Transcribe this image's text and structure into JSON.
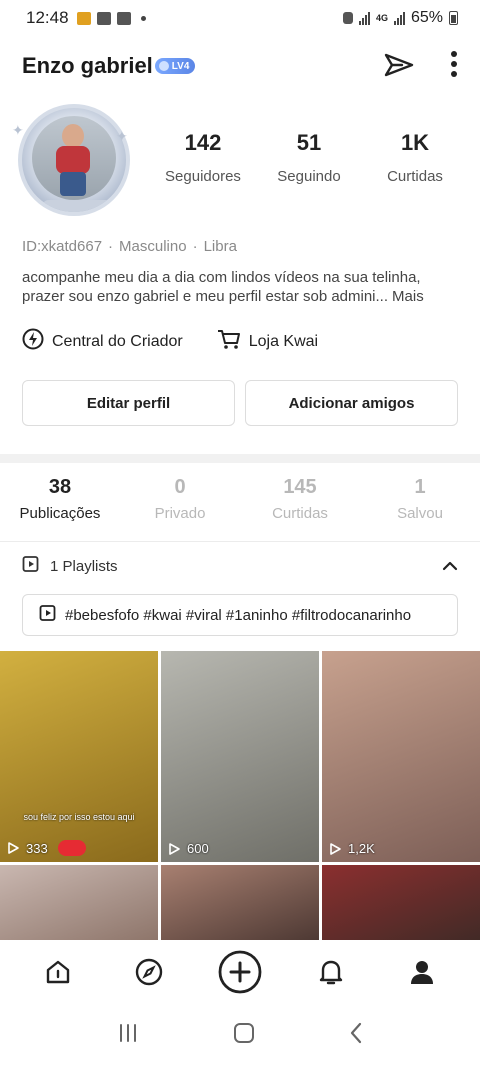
{
  "status_bar": {
    "time": "12:48",
    "network": "4G",
    "battery": "65%"
  },
  "profile": {
    "name": "Enzo gabriel",
    "level_badge": "LV4",
    "stats": [
      {
        "value": "142",
        "label": "Seguidores"
      },
      {
        "value": "51",
        "label": "Seguindo"
      },
      {
        "value": "1K",
        "label": "Curtidas"
      }
    ],
    "id": "ID:xkatd667",
    "gender": "Masculino",
    "sign": "Libra",
    "bio_line1": "acompanhe meu dia a dia com lindos vídeos na sua telinha,",
    "bio_line2": "prazer sou enzo gabriel e meu perfil estar sob admini...",
    "bio_more": "Mais"
  },
  "links": {
    "creator_center": "Central do Criador",
    "shop": "Loja Kwai"
  },
  "buttons": {
    "edit_profile": "Editar perfil",
    "add_friends": "Adicionar amigos"
  },
  "tabs": [
    {
      "count": "38",
      "label": "Publicações",
      "active": true
    },
    {
      "count": "0",
      "label": "Privado",
      "active": false
    },
    {
      "count": "145",
      "label": "Curtidas",
      "active": false
    },
    {
      "count": "1",
      "label": "Salvou",
      "active": false
    }
  ],
  "playlists": {
    "label": "1 Playlists",
    "tags": "#bebesfofo #kwai #viral #1aninho #filtrodocanarinho"
  },
  "videos": [
    {
      "views": "333",
      "caption": "sou feliz por isso estou aqui",
      "colors": [
        "#d2b040",
        "#8a6a1c"
      ]
    },
    {
      "views": "600",
      "caption": "",
      "colors": [
        "#b7b7b0",
        "#6f6f68"
      ]
    },
    {
      "views": "1,2K",
      "caption": "",
      "colors": [
        "#c7a18e",
        "#7d5f57"
      ]
    },
    {
      "views": "",
      "caption": "",
      "colors": [
        "#c9b7b0",
        "#8c7368"
      ]
    },
    {
      "views": "",
      "caption": "",
      "colors": [
        "#a88071",
        "#4a3631"
      ]
    },
    {
      "views": "",
      "caption": "",
      "colors": [
        "#8b2f2f",
        "#3f2a26"
      ]
    }
  ],
  "icons": {
    "share": "share-arrow-icon",
    "more": "more-vertical-icon",
    "creator": "lightning-icon",
    "shop": "cart-icon",
    "playlist": "playlist-icon",
    "chevron": "chevron-up-icon",
    "home": "home-icon",
    "discover": "compass-icon",
    "create": "plus-icon",
    "notifications": "bell-icon",
    "profile": "person-icon"
  }
}
